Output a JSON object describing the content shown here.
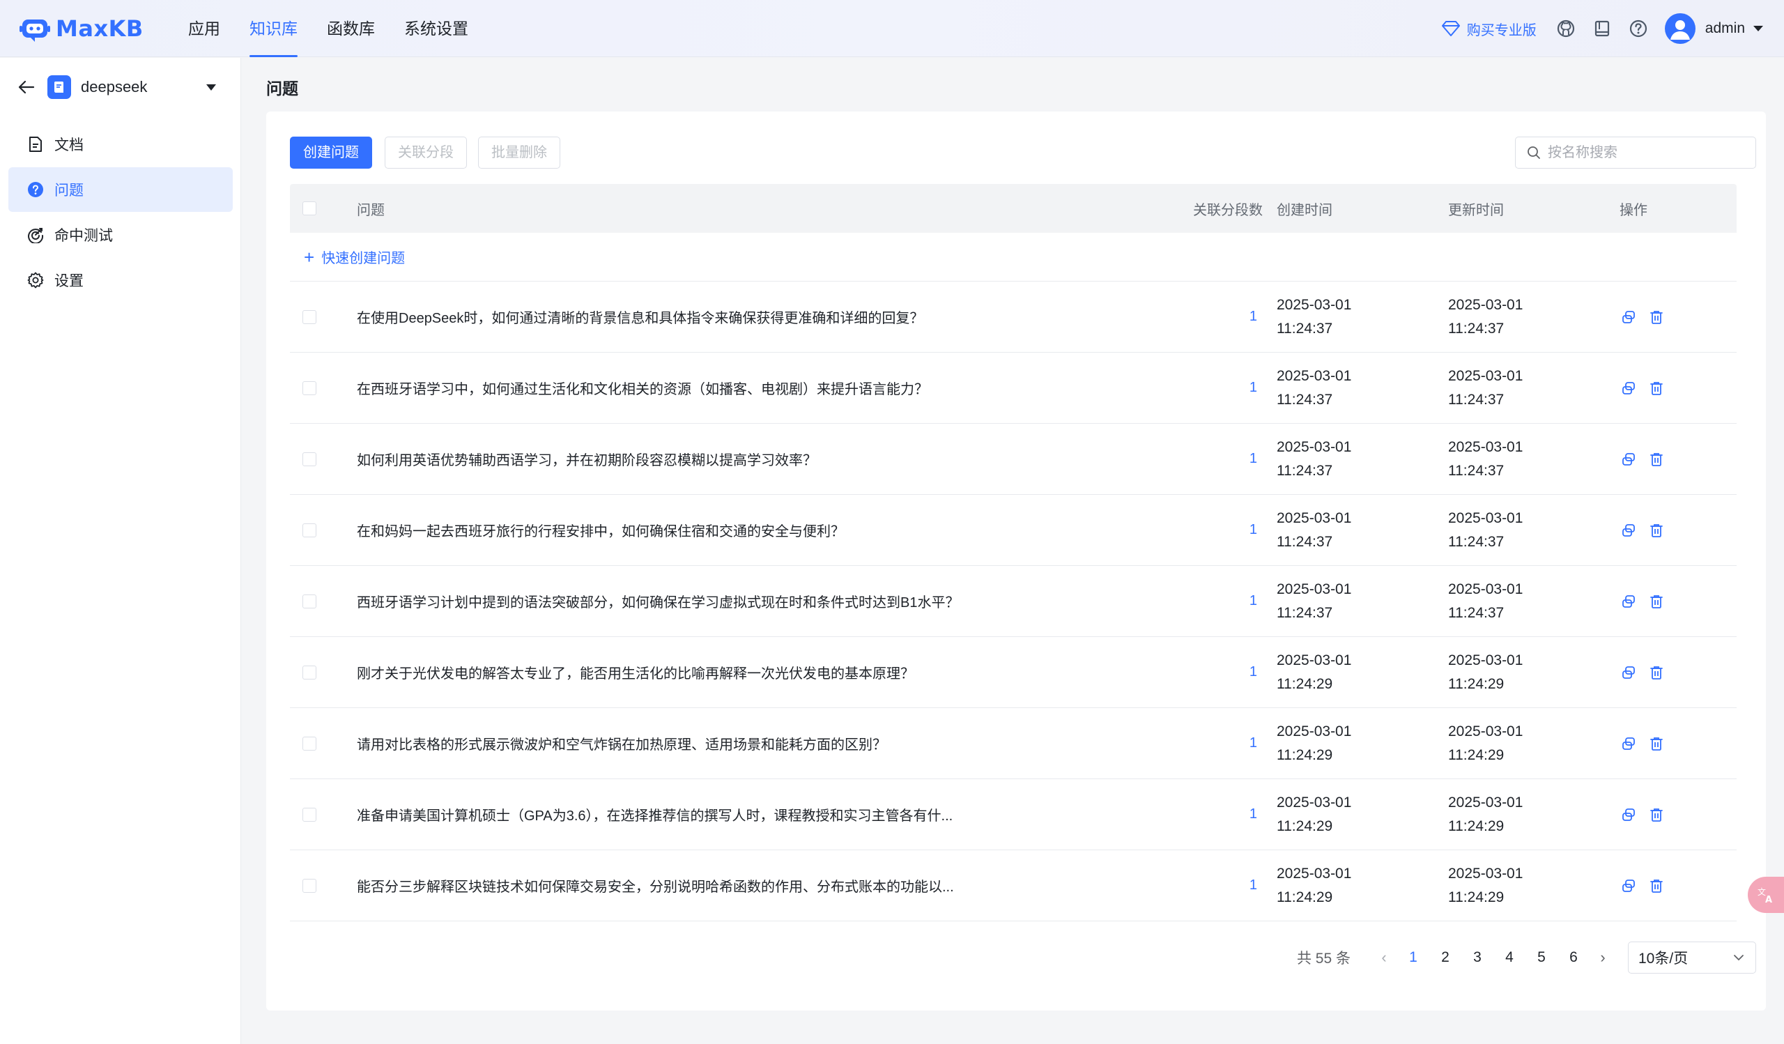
{
  "app": {
    "logo_text": "MaxKB"
  },
  "nav": {
    "items": [
      {
        "label": "应用",
        "active": false
      },
      {
        "label": "知识库",
        "active": true
      },
      {
        "label": "函数库",
        "active": false
      },
      {
        "label": "系统设置",
        "active": false
      }
    ]
  },
  "header": {
    "buy_pro": "购买专业版",
    "username": "admin"
  },
  "sidebar": {
    "kb_name": "deepseek",
    "items": [
      {
        "label": "文档",
        "icon": "document-icon",
        "active": false
      },
      {
        "label": "问题",
        "icon": "question-icon",
        "active": true
      },
      {
        "label": "命中测试",
        "icon": "target-icon",
        "active": false
      },
      {
        "label": "设置",
        "icon": "gear-icon",
        "active": false
      }
    ]
  },
  "page": {
    "title": "问题"
  },
  "toolbar": {
    "create_label": "创建问题",
    "link_label": "关联分段",
    "delete_label": "批量删除",
    "search_placeholder": "按名称搜索"
  },
  "table": {
    "columns": {
      "question": "问题",
      "segments": "关联分段数",
      "created": "创建时间",
      "updated": "更新时间",
      "ops": "操作"
    },
    "quick_create": "快速创建问题",
    "rows": [
      {
        "question": "在使用DeepSeek时，如何通过清晰的背景信息和具体指令来确保获得更准确和详细的回复？",
        "segments": "1",
        "created_date": "2025-03-01",
        "created_time": "11:24:37",
        "updated_date": "2025-03-01",
        "updated_time": "11:24:37"
      },
      {
        "question": "在西班牙语学习中，如何通过生活化和文化相关的资源（如播客、电视剧）来提升语言能力？",
        "segments": "1",
        "created_date": "2025-03-01",
        "created_time": "11:24:37",
        "updated_date": "2025-03-01",
        "updated_time": "11:24:37"
      },
      {
        "question": "如何利用英语优势辅助西语学习，并在初期阶段容忍模糊以提高学习效率？",
        "segments": "1",
        "created_date": "2025-03-01",
        "created_time": "11:24:37",
        "updated_date": "2025-03-01",
        "updated_time": "11:24:37"
      },
      {
        "question": "在和妈妈一起去西班牙旅行的行程安排中，如何确保住宿和交通的安全与便利？",
        "segments": "1",
        "created_date": "2025-03-01",
        "created_time": "11:24:37",
        "updated_date": "2025-03-01",
        "updated_time": "11:24:37"
      },
      {
        "question": "西班牙语学习计划中提到的语法突破部分，如何确保在学习虚拟式现在时和条件式时达到B1水平？",
        "segments": "1",
        "created_date": "2025-03-01",
        "created_time": "11:24:37",
        "updated_date": "2025-03-01",
        "updated_time": "11:24:37"
      },
      {
        "question": "刚才关于光伏发电的解答太专业了，能否用生活化的比喻再解释一次光伏发电的基本原理？",
        "segments": "1",
        "created_date": "2025-03-01",
        "created_time": "11:24:29",
        "updated_date": "2025-03-01",
        "updated_time": "11:24:29"
      },
      {
        "question": "请用对比表格的形式展示微波炉和空气炸锅在加热原理、适用场景和能耗方面的区别？",
        "segments": "1",
        "created_date": "2025-03-01",
        "created_time": "11:24:29",
        "updated_date": "2025-03-01",
        "updated_time": "11:24:29"
      },
      {
        "question": "准备申请美国计算机硕士（GPA为3.6），在选择推荐信的撰写人时，课程教授和实习主管各有什...",
        "segments": "1",
        "created_date": "2025-03-01",
        "created_time": "11:24:29",
        "updated_date": "2025-03-01",
        "updated_time": "11:24:29"
      },
      {
        "question": "能否分三步解释区块链技术如何保障交易安全，分别说明哈希函数的作用、分布式账本的功能以...",
        "segments": "1",
        "created_date": "2025-03-01",
        "created_time": "11:24:29",
        "updated_date": "2025-03-01",
        "updated_time": "11:24:29"
      }
    ]
  },
  "pagination": {
    "total_label": "共 55 条",
    "pages": [
      "1",
      "2",
      "3",
      "4",
      "5",
      "6"
    ],
    "current": "1",
    "page_size": "10条/页"
  },
  "colors": {
    "accent": "#3370ff",
    "float_button": "#f4a7b9"
  }
}
